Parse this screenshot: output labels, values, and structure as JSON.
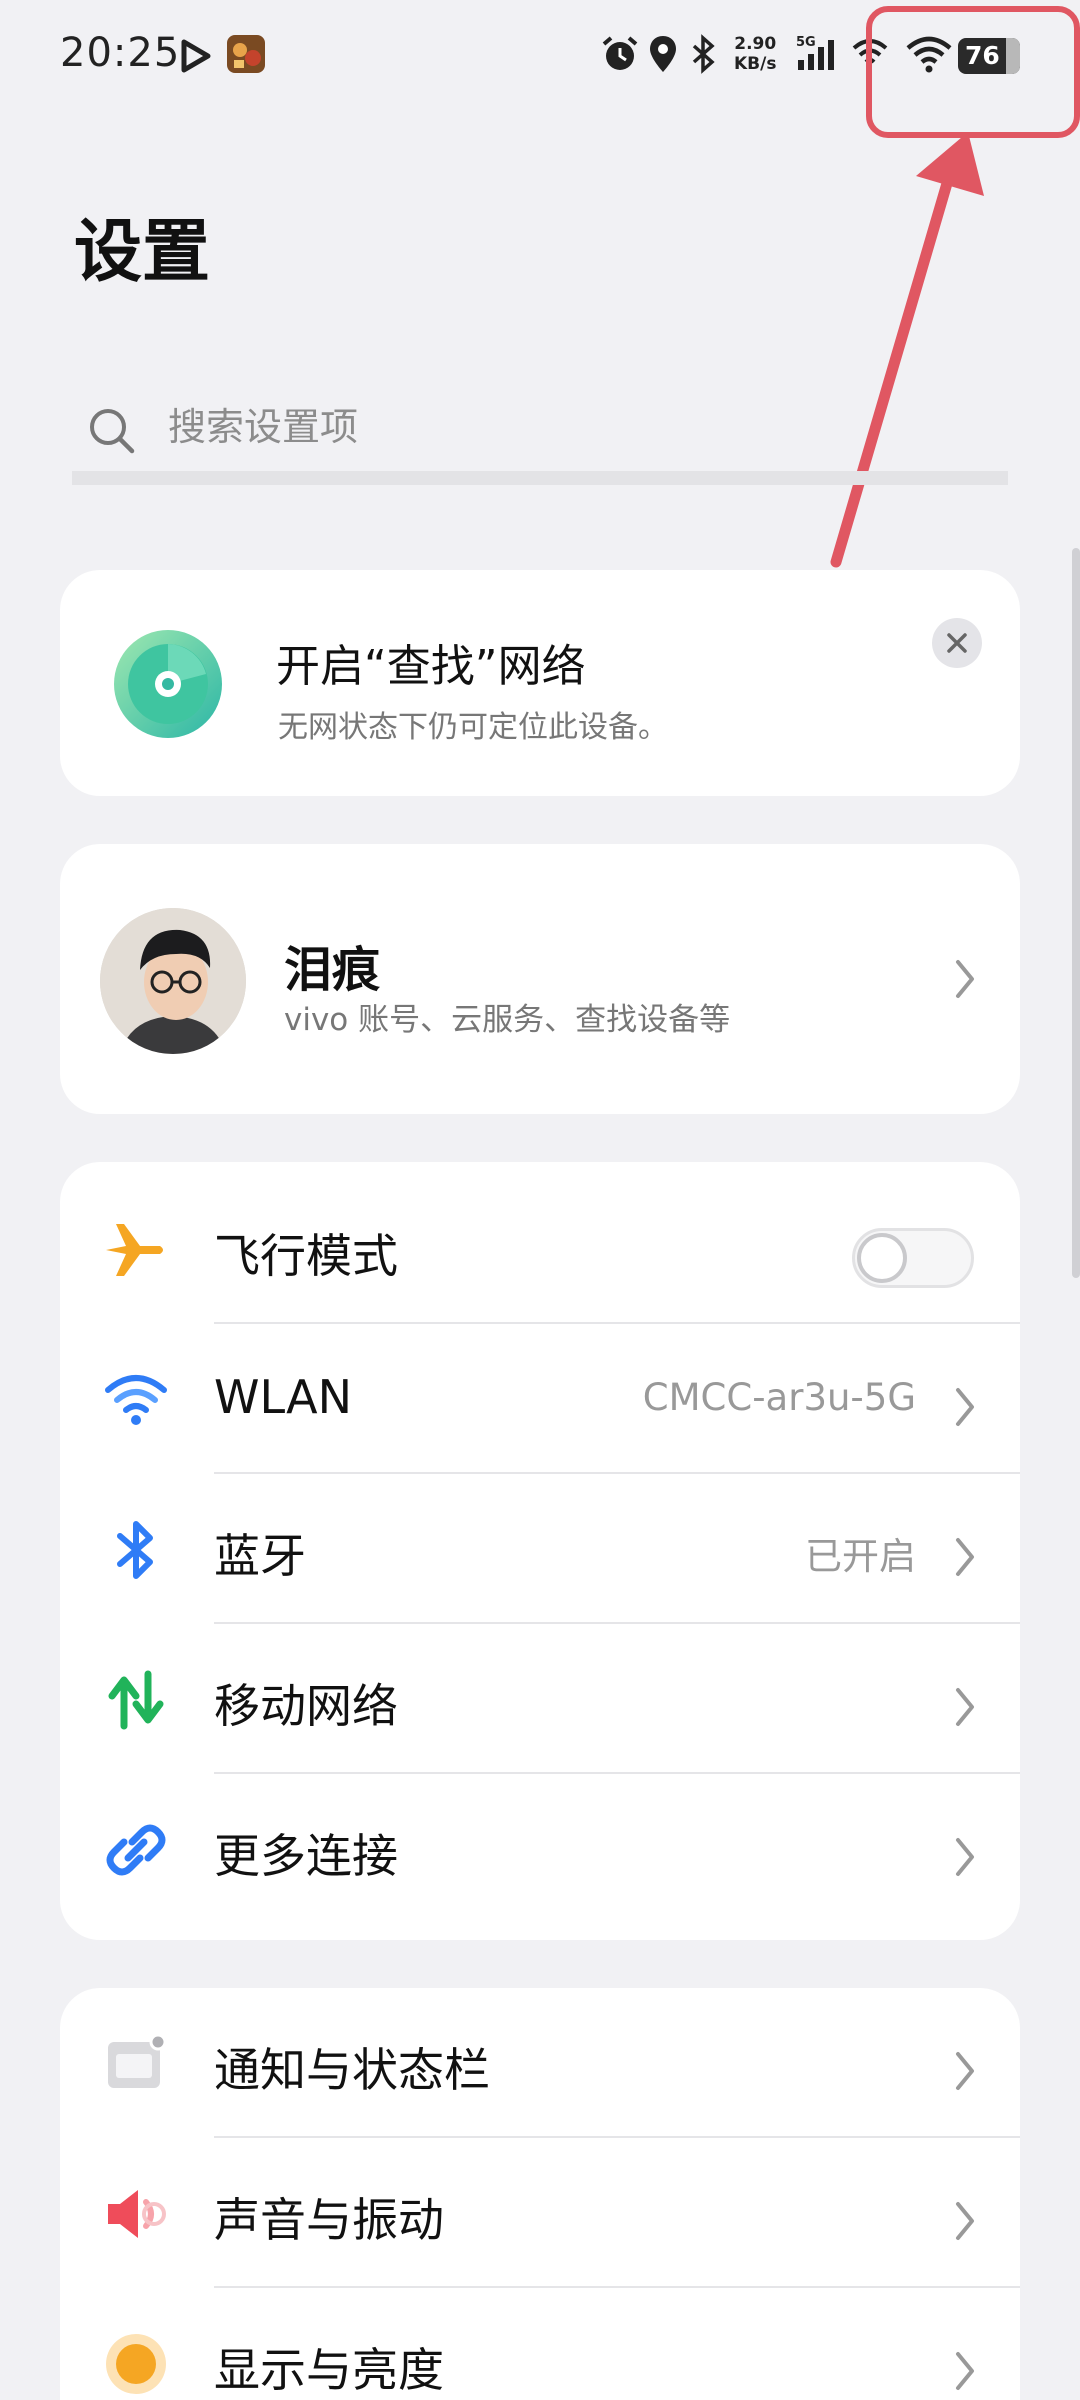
{
  "status_bar": {
    "time": "20:25",
    "speed_value": "2.90",
    "speed_unit": "KB/s",
    "signal_type": "5G",
    "battery": "76",
    "icons": [
      "play-icon",
      "game-app-icon",
      "alarm-icon",
      "location-icon",
      "bluetooth-icon",
      "signal-icon",
      "hotspot-icon",
      "wifi-icon",
      "battery-icon"
    ]
  },
  "page": {
    "title": "设置"
  },
  "search": {
    "placeholder": "搜索设置项"
  },
  "find_card": {
    "title": "开启“查找”网络",
    "subtitle": "无网状态下仍可定位此设备。"
  },
  "account": {
    "name": "泪痕",
    "subtitle": "vivo 账号、云服务、查找设备等"
  },
  "connectivity": [
    {
      "label": "飞行模式",
      "icon": "airplane-icon",
      "toggle": false
    },
    {
      "label": "WLAN",
      "icon": "wifi-icon",
      "value": "CMCC-ar3u-5G"
    },
    {
      "label": "蓝牙",
      "icon": "bluetooth-icon",
      "value": "已开启"
    },
    {
      "label": "移动网络",
      "icon": "mobile-data-icon"
    },
    {
      "label": "更多连接",
      "icon": "link-icon"
    }
  ],
  "system": [
    {
      "label": "通知与状态栏",
      "icon": "notification-icon"
    },
    {
      "label": "声音与振动",
      "icon": "speaker-icon"
    },
    {
      "label": "显示与亮度",
      "icon": "display-icon"
    }
  ],
  "colors": {
    "background": "#f1f1f4",
    "card": "#ffffff",
    "accent_blue": "#2f7cf6",
    "airplane": "#f5a623",
    "mobile_green": "#21b35a",
    "sound_red": "#ef4c5a",
    "annotation": "#e05762"
  }
}
